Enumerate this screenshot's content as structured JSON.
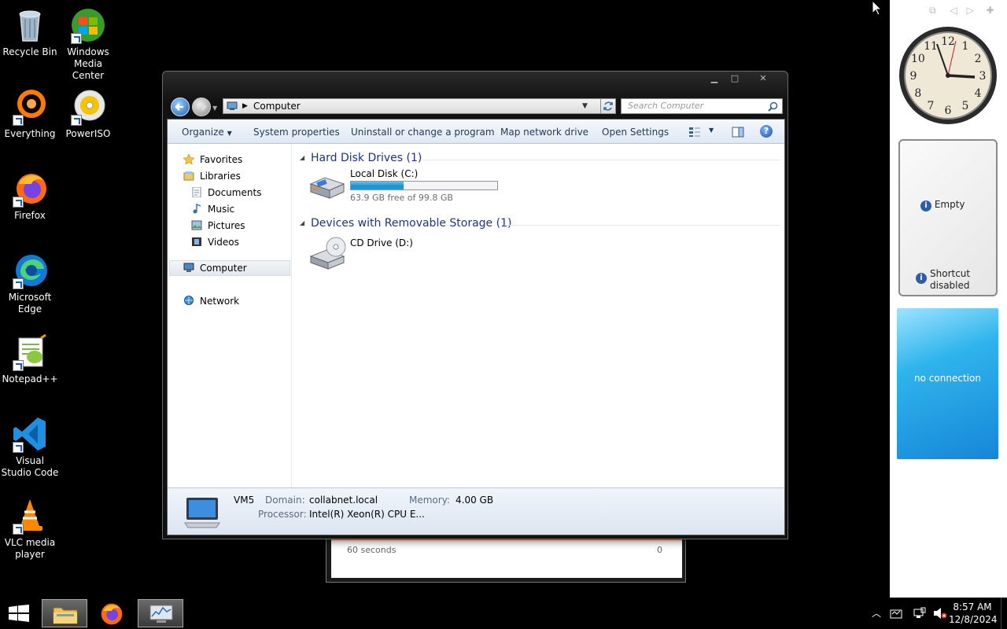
{
  "desktop_icons": [
    {
      "label": "Recycle Bin",
      "icon": "recycle-bin-icon"
    },
    {
      "label": "Windows Media Center",
      "icon": "media-center-icon"
    },
    {
      "label": "Everything",
      "icon": "everything-icon"
    },
    {
      "label": "PowerISO",
      "icon": "poweriso-icon"
    },
    {
      "label": "Firefox",
      "icon": "firefox-icon"
    },
    {
      "label": "Microsoft Edge",
      "icon": "edge-icon"
    },
    {
      "label": "Notepad++",
      "icon": "notepadpp-icon"
    },
    {
      "label": "Visual Studio Code",
      "icon": "vscode-icon"
    },
    {
      "label": "VLC media player",
      "icon": "vlc-icon"
    }
  ],
  "explorer": {
    "address": "Computer",
    "search_placeholder": "Search Computer",
    "commands": {
      "organize": "Organize",
      "system_properties": "System properties",
      "uninstall": "Uninstall or change a program",
      "map_drive": "Map network drive",
      "open_settings": "Open Settings"
    },
    "nav": {
      "favorites": "Favorites",
      "libraries": "Libraries",
      "documents": "Documents",
      "music": "Music",
      "pictures": "Pictures",
      "videos": "Videos",
      "computer": "Computer",
      "network": "Network"
    },
    "groups": {
      "hdd": "Hard Disk Drives (1)",
      "removable": "Devices with Removable Storage (1)"
    },
    "drives": {
      "c_label": "Local Disk (C:)",
      "c_free": "63.9 GB free of 99.8 GB",
      "c_used_fraction": 0.36,
      "d_label": "CD Drive (D:)"
    },
    "details": {
      "name": "VM5",
      "domain_label": "Domain:",
      "domain_value": "collabnet.local",
      "memory_label": "Memory:",
      "memory_value": "4.00 GB",
      "processor_label": "Processor:",
      "processor_value": "Intel(R) Xeon(R) CPU E..."
    }
  },
  "behind_window": {
    "row_label": "60 seconds",
    "row_value": "0"
  },
  "gadgets": {
    "slideshow_empty": "Empty",
    "shortcut_disabled": "Shortcut disabled",
    "weather": "no connection"
  },
  "clock": {
    "numbers": [
      "12",
      "1",
      "2",
      "3",
      "4",
      "5",
      "6",
      "7",
      "8",
      "9",
      "10",
      "11"
    ]
  },
  "taskbar": {
    "time": "8:57 AM",
    "date": "12/8/2024"
  }
}
